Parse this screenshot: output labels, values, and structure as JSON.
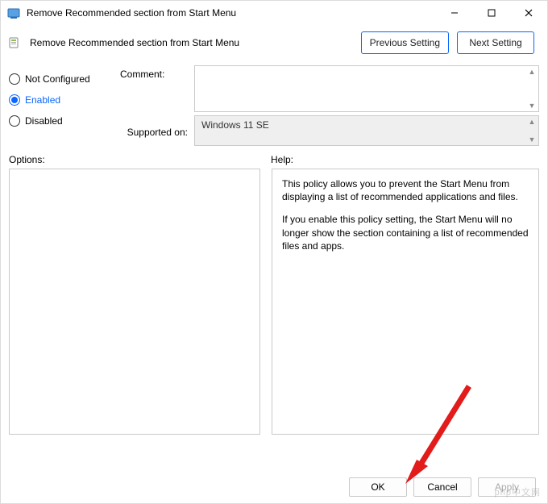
{
  "window": {
    "title": "Remove Recommended section from Start Menu"
  },
  "header": {
    "policy_title": "Remove Recommended section from Start Menu",
    "prev_btn": "Previous Setting",
    "next_btn": "Next Setting"
  },
  "state": {
    "not_configured": "Not Configured",
    "enabled": "Enabled",
    "disabled": "Disabled",
    "selected": "enabled"
  },
  "fields": {
    "comment_label": "Comment:",
    "comment_value": "",
    "supported_label": "Supported on:",
    "supported_value": "Windows 11 SE"
  },
  "mid": {
    "options_label": "Options:",
    "help_label": "Help:"
  },
  "help": {
    "p1": "This policy allows you to prevent the Start Menu from displaying a list of recommended applications and files.",
    "p2": "If you enable this policy setting, the Start Menu will no longer show the section containing a list of recommended files and apps."
  },
  "footer": {
    "ok": "OK",
    "cancel": "Cancel",
    "apply": "Apply"
  },
  "watermark": "php中文网"
}
